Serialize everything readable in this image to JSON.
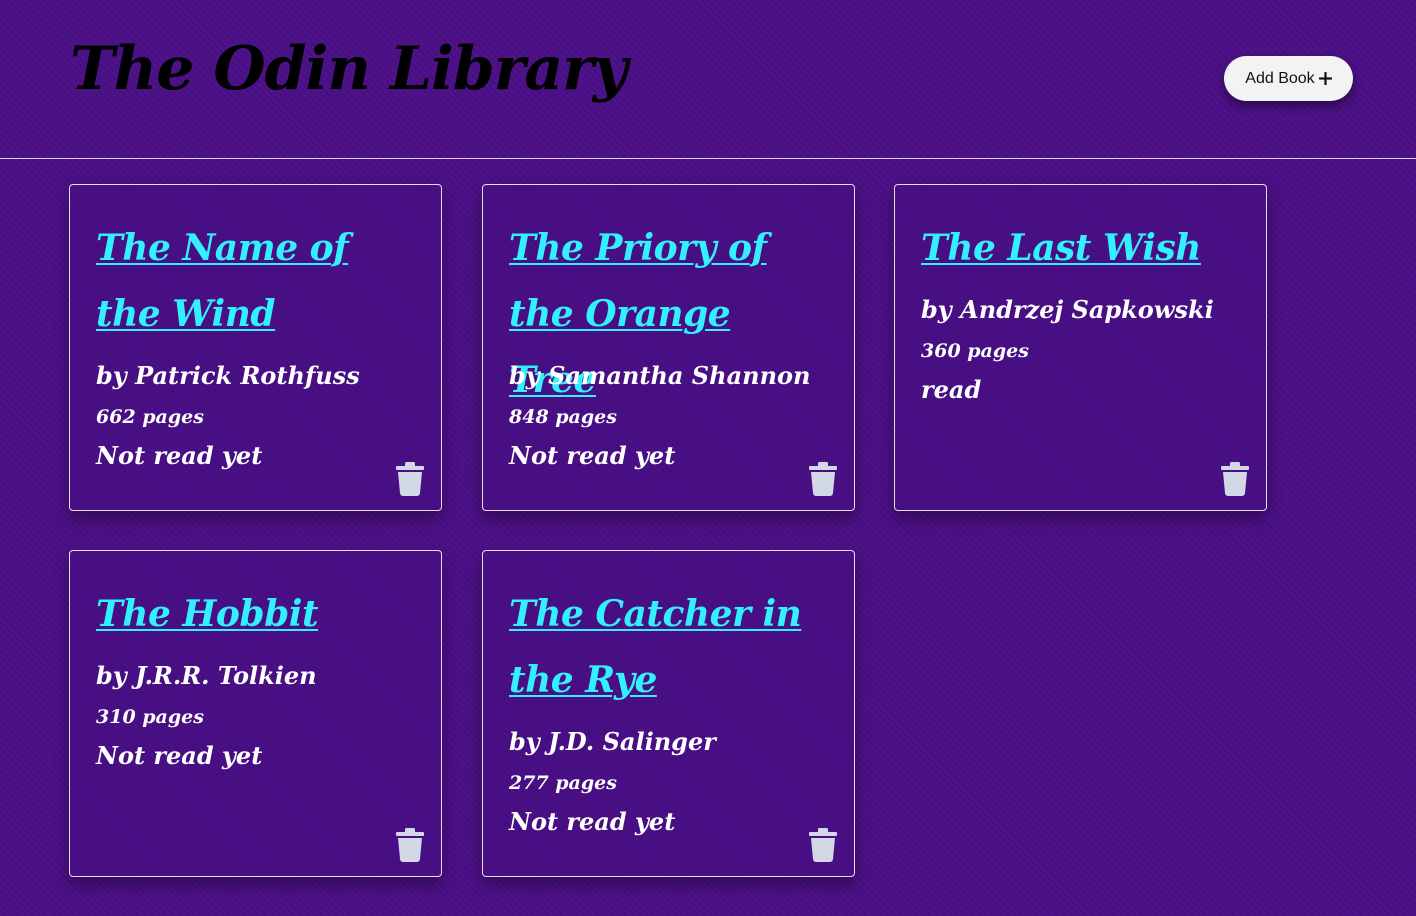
{
  "header": {
    "title": "The Odin Library",
    "add_button_label": "Add Book"
  },
  "colors": {
    "background": "#4a0f86",
    "title_link": "#33f0ff",
    "text": "#ffffff",
    "trash_icon": "#d3d8e6"
  },
  "icons": {
    "add": "plus-icon",
    "delete": "trash-icon"
  },
  "books": [
    {
      "title": "The Name of the Wind",
      "author": "by Patrick Rothfuss",
      "pages": "662 pages",
      "status": "Not read yet"
    },
    {
      "title": "The Priory of the Orange Tree",
      "author": "by Samantha Shannon",
      "pages": "848 pages",
      "status": "Not read yet"
    },
    {
      "title": "The Last Wish",
      "author": "by Andrzej Sapkowski",
      "pages": "360 pages",
      "status": "read"
    },
    {
      "title": "The Hobbit",
      "author": "by J.R.R. Tolkien",
      "pages": "310 pages",
      "status": "Not read yet"
    },
    {
      "title": "The Catcher in the Rye",
      "author": "by J.D. Salinger",
      "pages": "277 pages",
      "status": "Not read yet"
    }
  ]
}
